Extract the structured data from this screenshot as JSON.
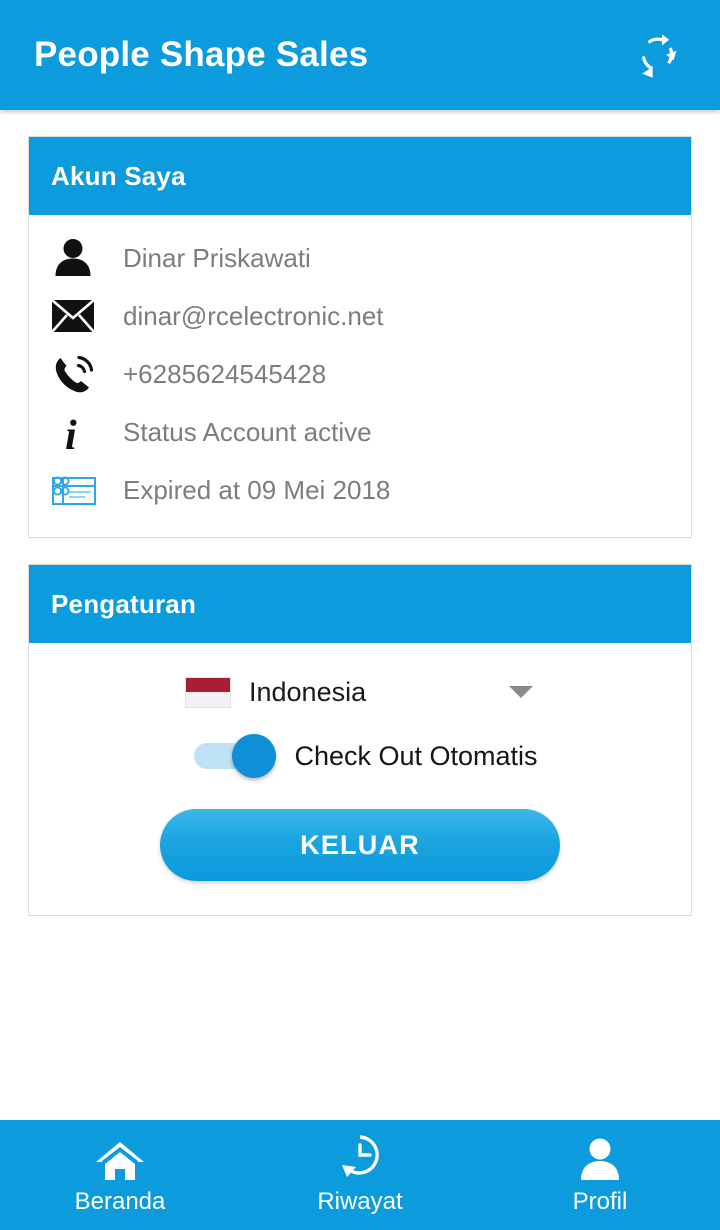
{
  "appbar": {
    "title": "People Shape Sales",
    "action_icon": "sync-refresh-icon"
  },
  "account_card": {
    "title": "Akun Saya",
    "rows": [
      {
        "icon": "person-icon",
        "text": "Dinar Priskawati"
      },
      {
        "icon": "envelope-icon",
        "text": "dinar@rcelectronic.net"
      },
      {
        "icon": "phone-ring-icon",
        "text": "+6285624545428"
      },
      {
        "icon": "info-icon",
        "text": "Status Account active"
      },
      {
        "icon": "gift-card-icon",
        "text": "Expired at  09 Mei 2018"
      }
    ]
  },
  "settings_card": {
    "title": "Pengaturan",
    "language": {
      "label": "Indonesia",
      "flag_icon": "indonesia-flag-icon",
      "caret_icon": "chevron-down-icon"
    },
    "auto_checkout": {
      "label": "Check Out Otomatis",
      "state": "on"
    },
    "logout_label": "KELUAR"
  },
  "bottom_nav": {
    "items": [
      {
        "label": "Beranda",
        "icon": "home-icon",
        "active": false
      },
      {
        "label": "Riwayat",
        "icon": "history-icon",
        "active": false
      },
      {
        "label": "Profil",
        "icon": "person-icon",
        "active": true
      }
    ]
  },
  "colors": {
    "primary": "#0c9bdd",
    "toggle_on": "#0f90d6",
    "flag_red": "#a81f33",
    "text_gray": "#7d7d7d"
  }
}
